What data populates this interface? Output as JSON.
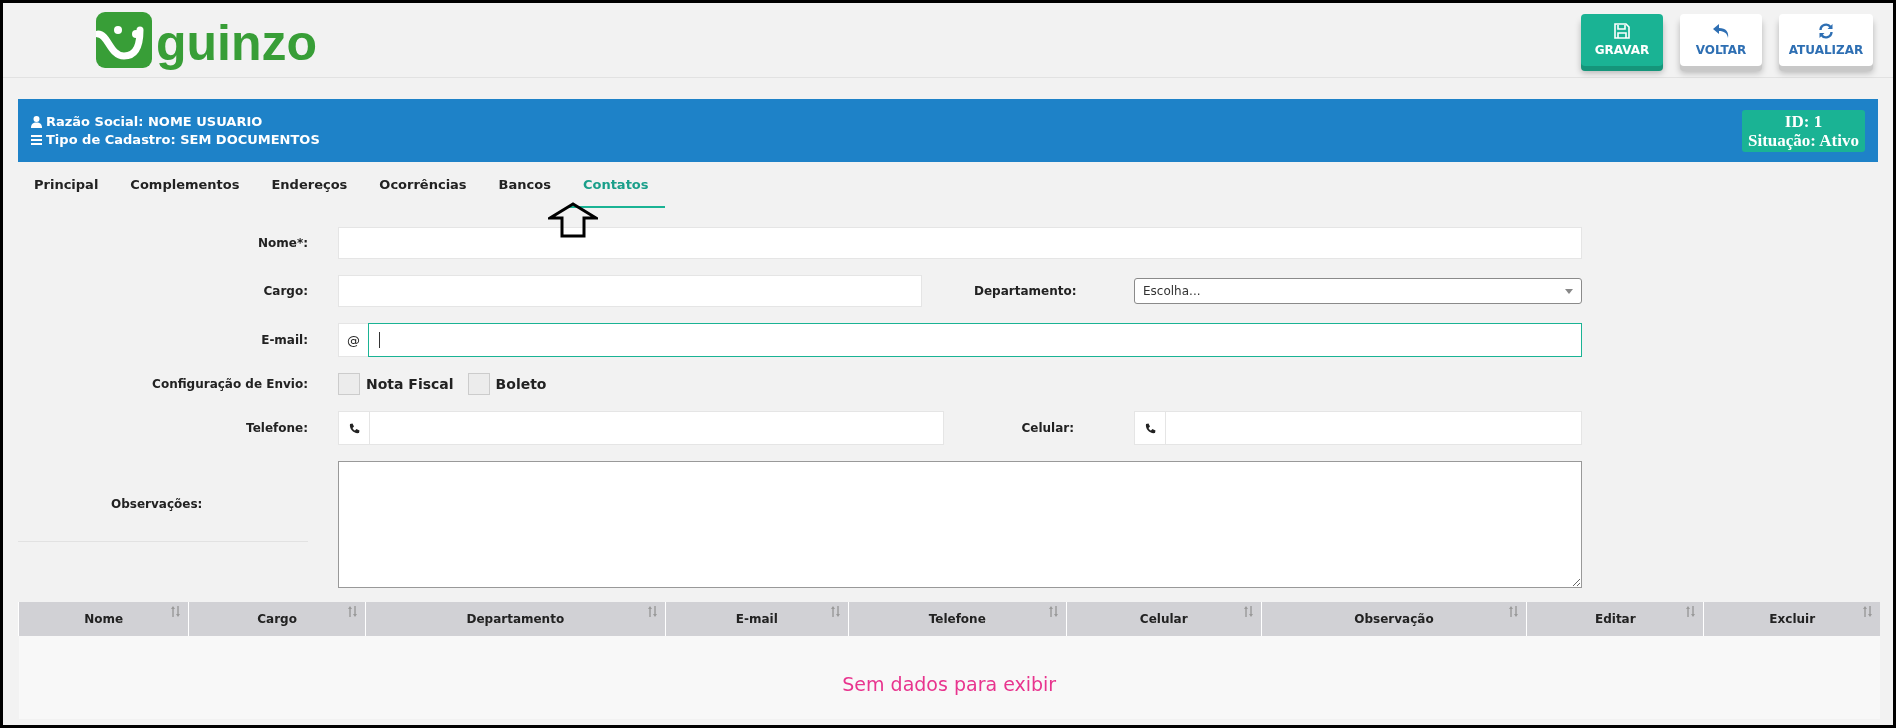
{
  "logo": {
    "text": "guinzo"
  },
  "toolbar": [
    {
      "label": "GRAVAR",
      "kind": "save"
    },
    {
      "label": "VOLTAR",
      "kind": "back"
    },
    {
      "label": "ATUALIZAR",
      "kind": "refresh"
    }
  ],
  "header": {
    "lines": [
      {
        "text": "Razão Social: NOME USUARIO",
        "kind": "user"
      },
      {
        "text": "Tipo de Cadastro: SEM DOCUMENTOS",
        "kind": "list"
      }
    ],
    "id": "ID: 1",
    "status": "Situação: Ativo"
  },
  "tabs": [
    {
      "label": "Principal",
      "selected": false
    },
    {
      "label": "Complementos",
      "selected": false
    },
    {
      "label": "Endereços",
      "selected": false
    },
    {
      "label": "Ocorrências",
      "selected": false
    },
    {
      "label": "Bancos",
      "selected": false
    },
    {
      "label": "Contatos",
      "selected": true
    }
  ],
  "form": {
    "rows": [
      [
        {
          "label": "Nome*:",
          "kind": "text",
          "focused": false
        }
      ],
      [
        {
          "label": "Cargo:",
          "kind": "text",
          "focused": false
        },
        {
          "label": "Departamento:",
          "kind": "select",
          "value": "Escolha...",
          "focused": false
        }
      ],
      [
        {
          "label": "E-mail:",
          "kind": "email",
          "addon": "@",
          "focused": true
        }
      ],
      [
        {
          "label": "Configuração de Envio:",
          "kind": "checkboxes",
          "options": [
            {
              "label": "Nota Fiscal",
              "checked": false
            },
            {
              "label": "Boleto",
              "checked": false
            }
          ]
        }
      ],
      [
        {
          "label": "Telefone:",
          "kind": "phone",
          "focused": false
        },
        {
          "label": "Celular:",
          "kind": "phone",
          "focused": false
        }
      ],
      [
        {
          "label": "Observações:",
          "kind": "textarea",
          "focused": false
        }
      ]
    ]
  },
  "table": {
    "columns": [
      "Nome",
      "Cargo",
      "Departamento",
      "E-mail",
      "Telefone",
      "Celular",
      "Observação",
      "Editar",
      "Excluir"
    ],
    "empty_message": "Sem dados para exibir"
  }
}
